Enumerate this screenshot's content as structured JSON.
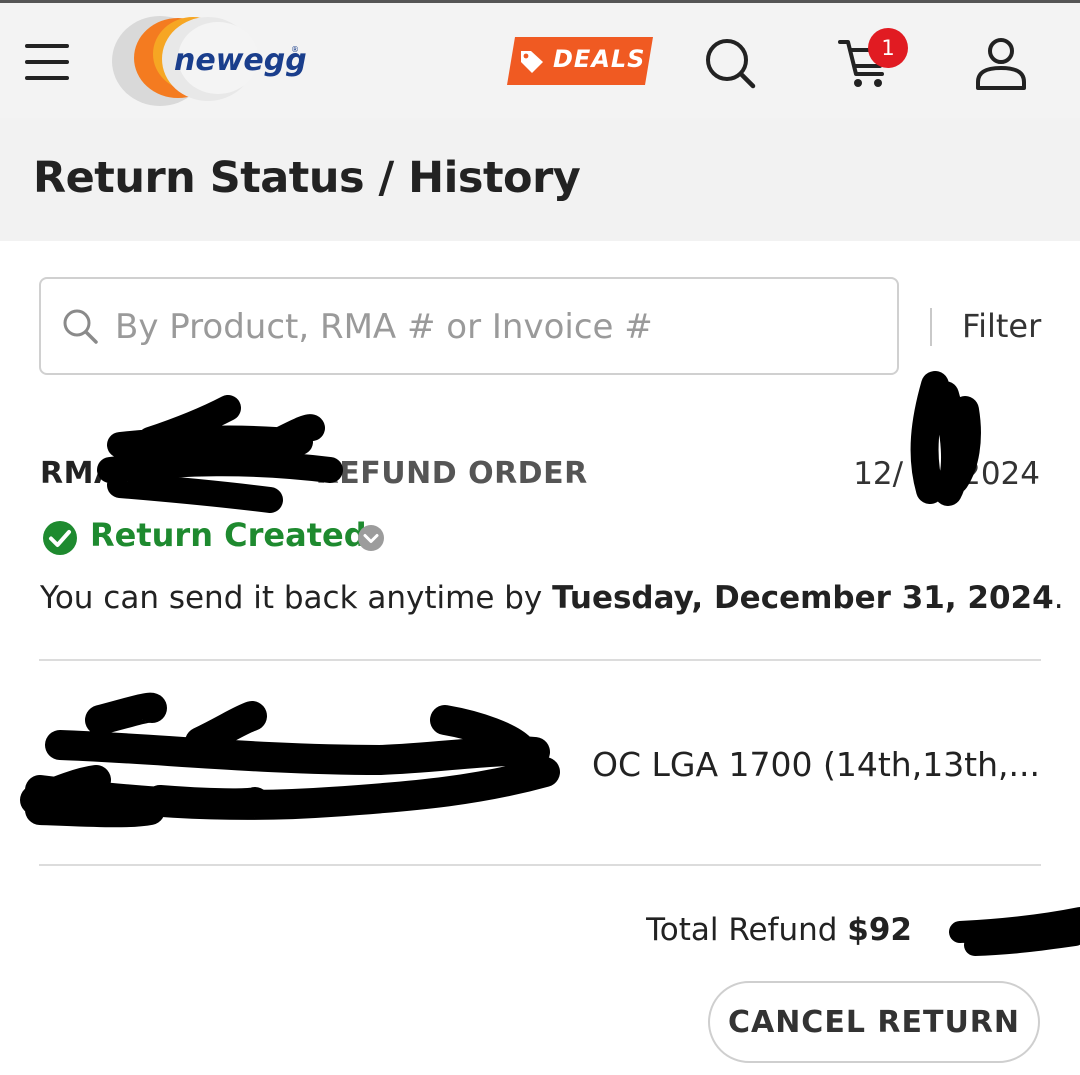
{
  "header": {
    "logo_text": "newegg",
    "deals_label": "DEALS",
    "cart_count": "1"
  },
  "page": {
    "title": "Return Status / History"
  },
  "search": {
    "placeholder": "By Product, RMA # or Invoice #",
    "value": "",
    "filter_label": "Filter"
  },
  "rma": {
    "prefix": "RMA",
    "type": "REFUND ORDER",
    "date_start": "12/",
    "date_end": "2024",
    "status": "Return Created",
    "note_prefix": "You can send it back anytime by ",
    "note_date": "Tuesday, December 31, 2024",
    "note_suffix": "."
  },
  "product": {
    "name": "OC LGA 1700 (14th,13th,..."
  },
  "totals": {
    "label": "Total Refund ",
    "amount_visible": "$92"
  },
  "actions": {
    "cancel_label": "CANCEL RETURN"
  },
  "colors": {
    "status_green": "#1e8a2f",
    "cart_badge": "#e11b22",
    "deals_orange": "#f05a22"
  }
}
